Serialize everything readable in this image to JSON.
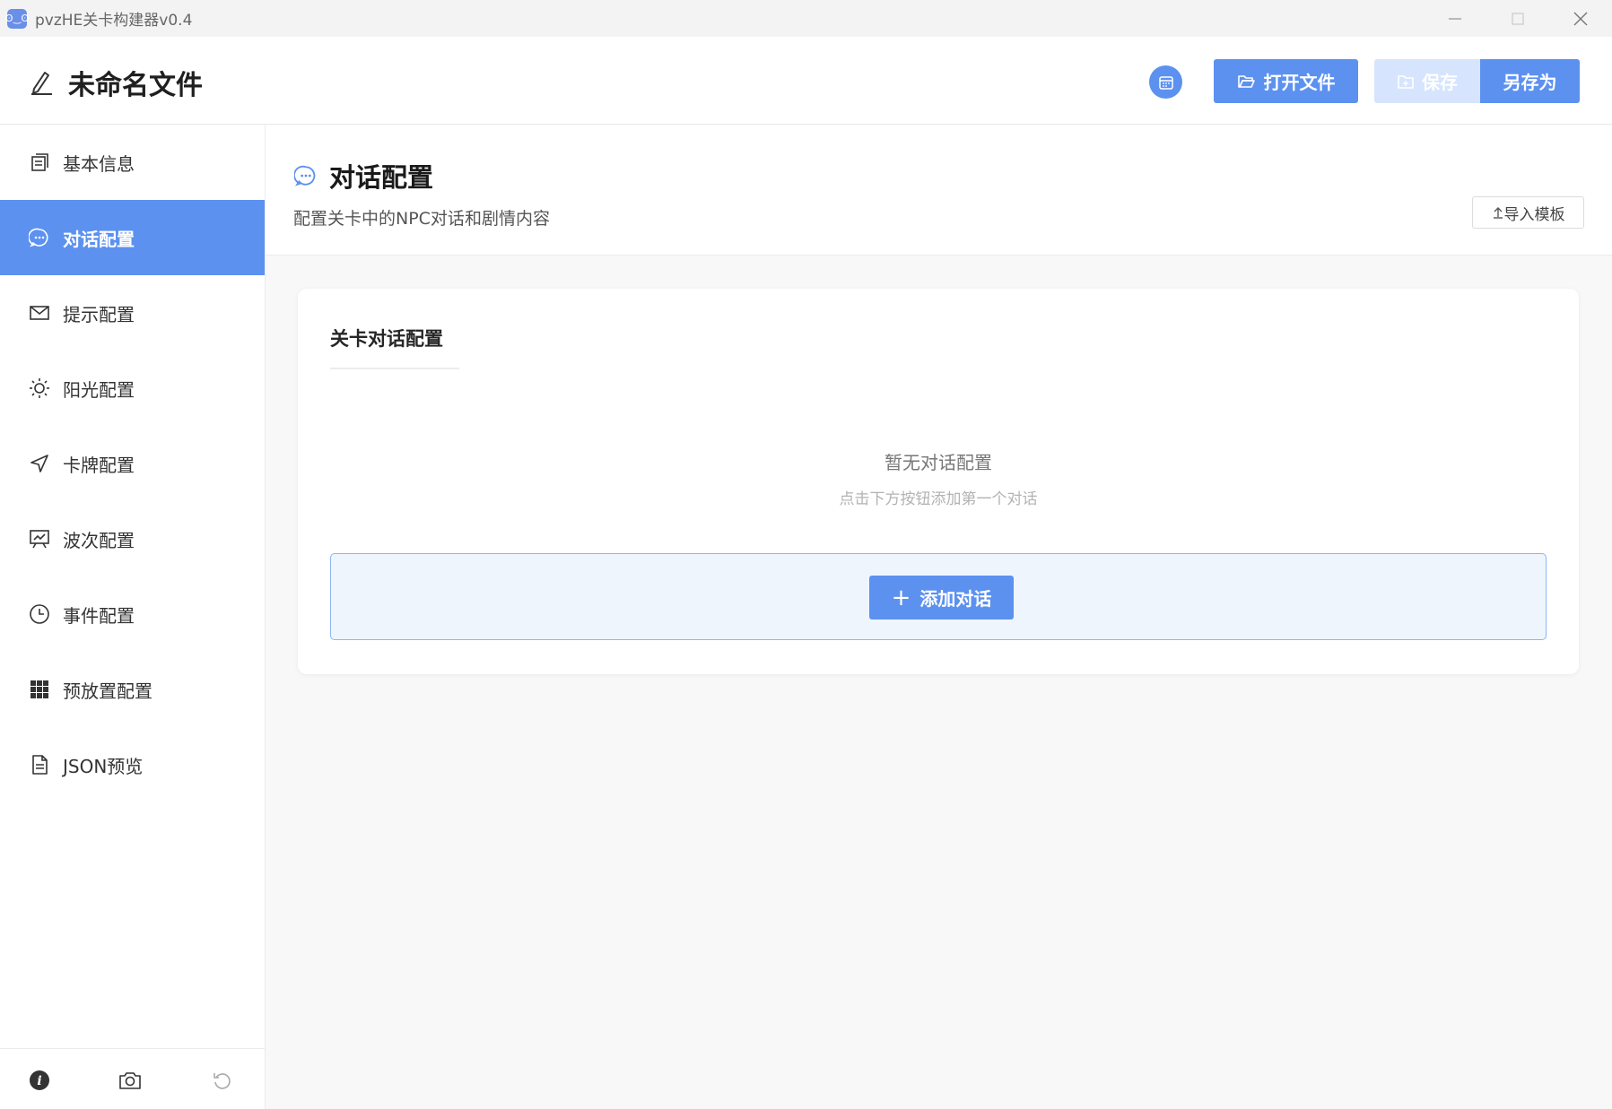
{
  "window": {
    "title": "pvzHE关卡构建器v0.4",
    "app_icon_glyph": "ʘ‿ʘ"
  },
  "header": {
    "file_title": "未命名文件",
    "open_label": "打开文件",
    "save_label": "保存",
    "save_as_label": "另存为"
  },
  "sidebar": {
    "items": [
      {
        "label": "基本信息",
        "icon": "document-list-icon",
        "active": false
      },
      {
        "label": "对话配置",
        "icon": "chat-bubble-icon",
        "active": true
      },
      {
        "label": "提示配置",
        "icon": "envelope-icon",
        "active": false
      },
      {
        "label": "阳光配置",
        "icon": "sun-icon",
        "active": false
      },
      {
        "label": "卡牌配置",
        "icon": "send-arrow-icon",
        "active": false
      },
      {
        "label": "波次配置",
        "icon": "presentation-chart-icon",
        "active": false
      },
      {
        "label": "事件配置",
        "icon": "clock-icon",
        "active": false
      },
      {
        "label": "预放置配置",
        "icon": "grid-icon",
        "active": false
      },
      {
        "label": "JSON预览",
        "icon": "file-text-icon",
        "active": false
      }
    ],
    "footer": [
      "info-icon",
      "camera-icon",
      "undo-icon"
    ]
  },
  "page": {
    "title": "对话配置",
    "subtitle": "配置关卡中的NPC对话和剧情内容",
    "import_label": "导入模板"
  },
  "card": {
    "title": "关卡对话配置",
    "empty_title": "暂无对话配置",
    "empty_hint": "点击下方按钮添加第一个对话",
    "add_label": "添加对话"
  },
  "colors": {
    "accent": "#5c91f0",
    "accent_disabled": "#d6e5fd",
    "add_zone_bg": "#eef5fd",
    "add_zone_border": "#8fb4ef"
  }
}
